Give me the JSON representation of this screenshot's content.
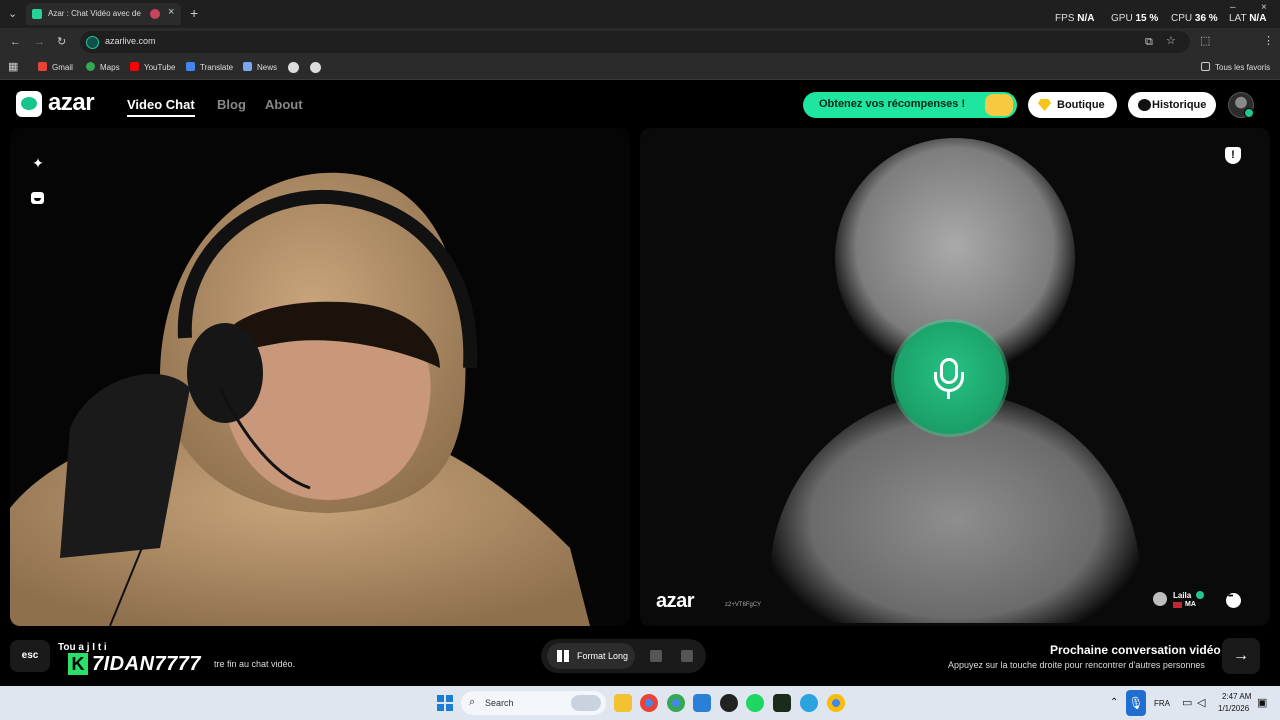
{
  "browser": {
    "tab_title": "Azar : Chat Vidéo avec de n",
    "url": "azarlive.com",
    "bookmarks": [
      "Gmail",
      "Maps",
      "YouTube",
      "Translate",
      "News"
    ],
    "all_bookmarks": "Tous les favoris",
    "perf": {
      "fps_label": "FPS",
      "fps_value": "N/A",
      "gpu_label": "GPU",
      "gpu_value": "15 %",
      "cpu_label": "CPU",
      "cpu_value": "36 %",
      "lat_label": "LAT",
      "lat_value": "N/A"
    }
  },
  "header": {
    "logo": "azar",
    "nav": [
      "Video Chat",
      "Blog",
      "About"
    ],
    "rewards": "Obtenez vos récompenses !",
    "shop": "Boutique",
    "history": "Historique"
  },
  "right_panel": {
    "watermark": "azar",
    "watermark_id": "z2+VT6FgCY",
    "user_name": "Laila",
    "user_country": "MA"
  },
  "bottom": {
    "esc": "esc",
    "hint_title": "Tou                a         j           I            t             i",
    "hint_sub": "tre fin au chat vidéo.",
    "streamer_tag": "7IDAN7777",
    "streamer_k": "K",
    "format_label": "Format Long",
    "next_title": "Prochaine conversation vidéo",
    "next_sub": "Appuyez sur la touche droite pour rencontrer d'autres personnes"
  },
  "taskbar": {
    "search": "Search",
    "lang": "FRA",
    "time": "2:47 AM",
    "date": "1/1/2026"
  },
  "colors": {
    "accent": "#1ee69f",
    "brand": "#17c489"
  }
}
